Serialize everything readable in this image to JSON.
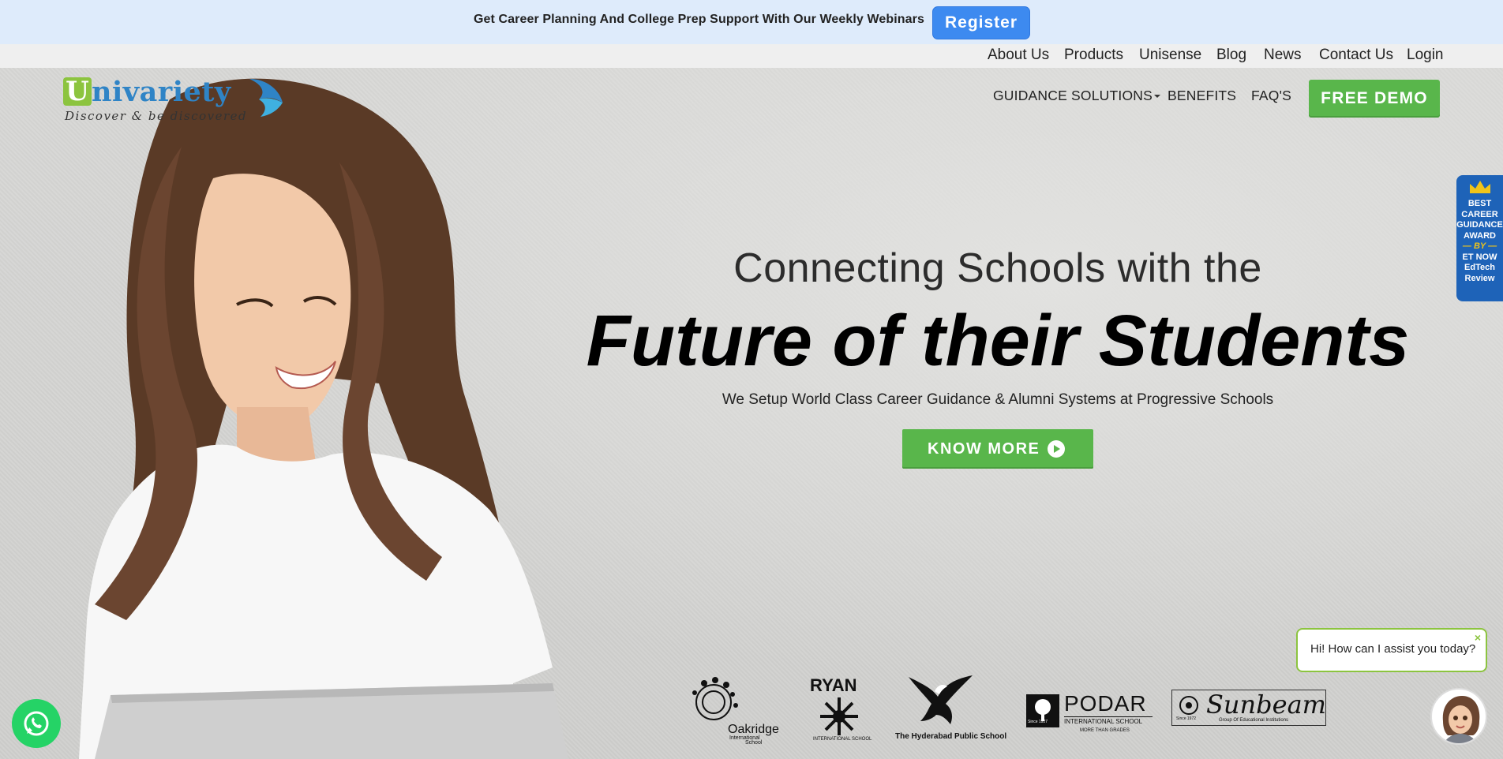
{
  "announcement": {
    "text": "Get Career Planning And College Prep Support With Our Weekly Webinars",
    "register_label": "Register"
  },
  "top_nav": [
    "About Us",
    "Products",
    "Unisense",
    "Blog",
    "News",
    "Contact Us",
    "Login"
  ],
  "logo": {
    "letter": "U",
    "word": "nivariety",
    "tagline": "Discover & be discovered"
  },
  "main_nav": {
    "items": [
      "GUIDANCE SOLUTIONS",
      "BENEFITS",
      "FAQ'S"
    ],
    "cta": "FREE DEMO"
  },
  "award": {
    "lines": [
      "BEST",
      "CAREER",
      "GUIDANCE",
      "AWARD",
      "— BY —",
      "ET NOW",
      "EdTech",
      "Review"
    ]
  },
  "hero": {
    "line1": "Connecting Schools with the",
    "line2": "Future of their Students",
    "subtitle": "We Setup World Class Career Guidance & Alumni Systems at Progressive Schools",
    "cta": "KNOW MORE"
  },
  "schools": {
    "oakridge": {
      "name": "Oakridge",
      "sub1": "International",
      "sub2": "School"
    },
    "ryan": {
      "name": "RYAN",
      "sub": "INTERNATIONAL SCHOOL"
    },
    "hps": {
      "name": "The Hyderabad Public School"
    },
    "podar": {
      "name": "PODAR",
      "sub": "INTERNATIONAL SCHOOL",
      "tag": "MORE THAN GRADES",
      "since": "Since 1927"
    },
    "sunbeam": {
      "name": "Sunbeam",
      "sub": "Group Of Educational Institutions",
      "since": "Since 1972"
    }
  },
  "chat": {
    "message": "Hi! How can I assist you today?",
    "close": "×"
  },
  "colors": {
    "announce_bg": "#deebfb",
    "register": "#3d8af0",
    "green": "#59b64b",
    "logo_blue": "#2f84c6",
    "logo_green": "#8cc43f",
    "award_blue": "#1e63b8",
    "whatsapp": "#25d366"
  },
  "icons": [
    "bird-logo-icon",
    "caret-down-icon",
    "crown-icon",
    "play-circle-icon",
    "whatsapp-icon",
    "close-icon",
    "chatbot-avatar-icon"
  ]
}
